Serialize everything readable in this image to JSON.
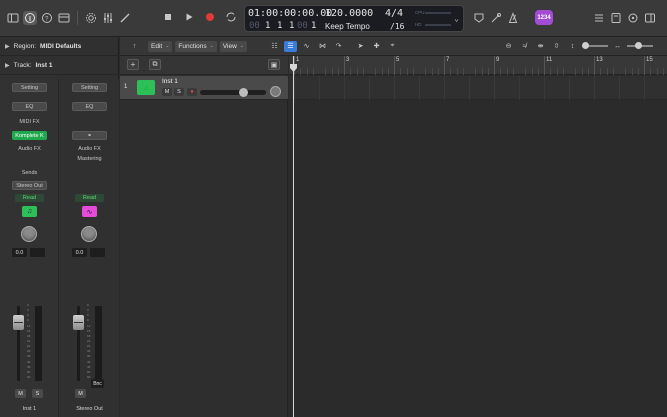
{
  "lcd": {
    "position_time": "01:00:00:00.00",
    "bars": "1",
    "beats": "1",
    "div": "1",
    "ticks": "1",
    "tempo": "120.0000",
    "tempo_mode": "Keep Tempo",
    "signature": "4/4",
    "division": "/16",
    "cpu_label": "CPU",
    "hd_label": "HD"
  },
  "badge": "1234",
  "inspector": {
    "region_prefix": "Region:",
    "region_value": "MIDI Defaults",
    "track_prefix": "Track:",
    "track_value": "Inst 1"
  },
  "strip1": {
    "setting": "Setting",
    "eq": "EQ",
    "midi_fx": "MIDI FX",
    "instrument": "Komplete K",
    "audio_fx": "Audio FX",
    "sends": "Sends",
    "output": "Stereo Out",
    "automation": "Read",
    "pan_value": "0.0",
    "mute": "M",
    "solo": "S",
    "name": "Inst 1"
  },
  "strip2": {
    "setting": "Setting",
    "eq": "EQ",
    "audio_fx": "Audio FX",
    "mastering": "Mastering",
    "automation": "Read",
    "pan_value": "0.0",
    "mute": "M",
    "bounce": "Bnc",
    "name": "Stereo Out"
  },
  "meter_scale": [
    "0",
    "3",
    "6",
    "9",
    "12",
    "15",
    "18",
    "21",
    "24",
    "30",
    "35",
    "40",
    "45",
    "50",
    "60"
  ],
  "toolbar": {
    "edit": "Edit",
    "functions": "Functions",
    "view": "View"
  },
  "track": {
    "number": "1",
    "name": "Inst 1",
    "mute": "M",
    "solo": "S",
    "rec": "R",
    "volume_level": 0.68
  },
  "ruler": {
    "labels": [
      "1",
      "3",
      "5",
      "7",
      "9",
      "11",
      "13",
      "15"
    ]
  },
  "colors": {
    "instrument_green": "#2fbf58",
    "selected_blue": "#3b7bd8",
    "record_red": "#e34b4b",
    "badge_purple": "#a24bd3",
    "stereo_out_pink": "#e54ad8"
  }
}
